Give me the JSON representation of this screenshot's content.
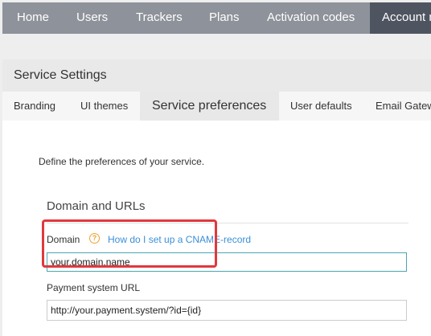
{
  "nav": {
    "items": [
      {
        "label": "Home"
      },
      {
        "label": "Users"
      },
      {
        "label": "Trackers"
      },
      {
        "label": "Plans"
      },
      {
        "label": "Activation codes"
      },
      {
        "label": "Account m",
        "active": true
      }
    ]
  },
  "panel": {
    "title": "Service Settings",
    "tabs": [
      {
        "label": "Branding"
      },
      {
        "label": "UI themes"
      },
      {
        "label": "Service preferences",
        "active": true
      },
      {
        "label": "User defaults"
      },
      {
        "label": "Email Gatew"
      }
    ]
  },
  "content": {
    "intro": "Define the preferences of your service.",
    "section_title": "Domain and URLs",
    "domain": {
      "label": "Domain",
      "help_icon": "question-circle-icon",
      "help_link": "How do I set up a CNAME-record",
      "value": "your.domain.name"
    },
    "payment": {
      "label": "Payment system URL",
      "value": "http://your.payment.system/?id={id}"
    }
  },
  "colors": {
    "nav_bg": "#8e929a",
    "nav_active_bg": "#4f5560",
    "link": "#3a8fd8",
    "help_icon": "#f0a030",
    "focus_border": "#4ba6b4",
    "highlight": "#e0393e"
  }
}
